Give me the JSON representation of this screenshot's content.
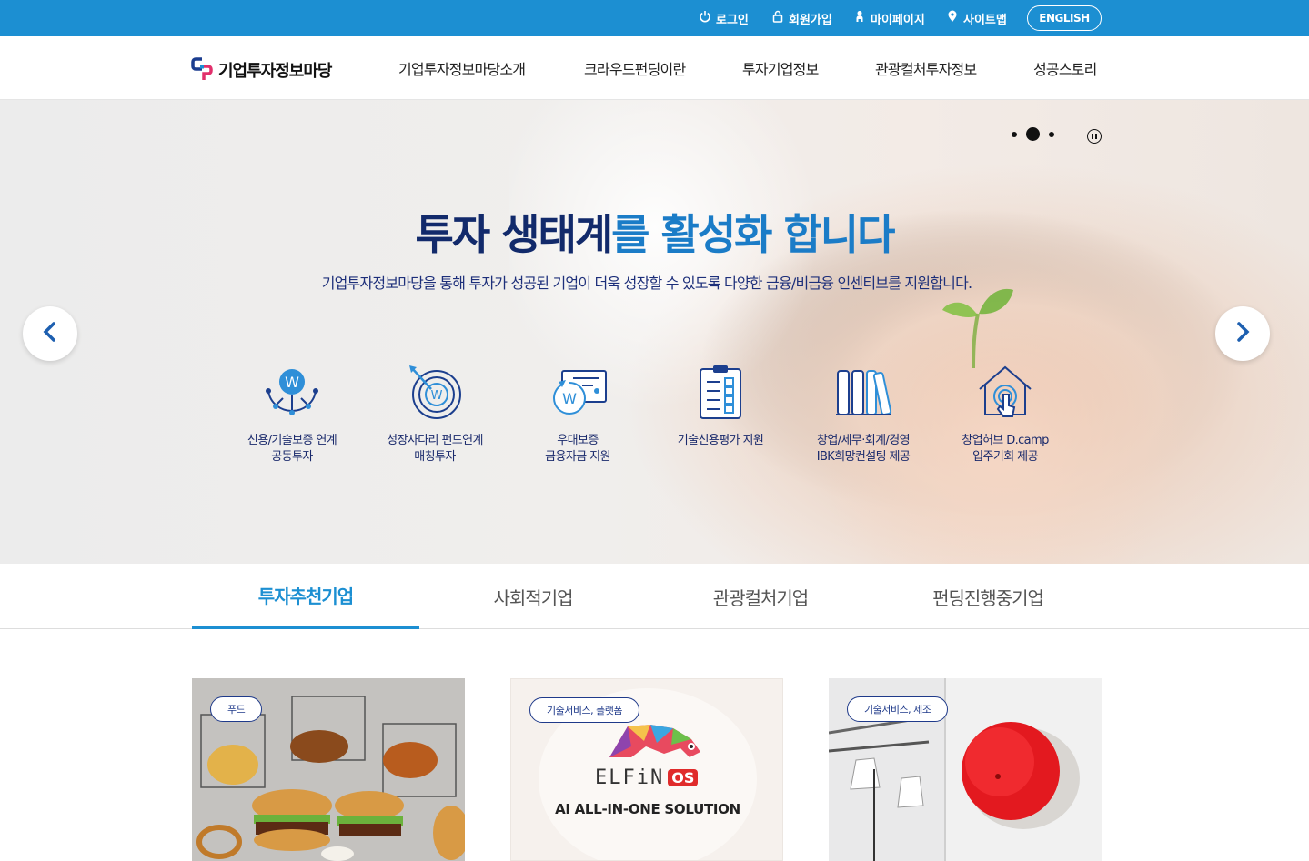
{
  "top_utility": {
    "login": "로그인",
    "signup": "회원가입",
    "mypage": "마이페이지",
    "sitemap": "사이트맵",
    "english": "ENGLISH"
  },
  "header": {
    "logo_text": "기업투자정보마당",
    "nav": [
      "기업투자정보마당소개",
      "크라우드펀딩이란",
      "투자기업정보",
      "관광컬처투자정보",
      "성공스토리"
    ]
  },
  "hero": {
    "title_part1": "투자 생태계",
    "title_part2": "를 활성화 합니다",
    "subtitle": "기업투자정보마당을 통해 투자가 성공된 기업이 더욱 성장할 수 있도록 다양한 금융/비금융 인센티브를 지원합니다.",
    "slide_count": 3,
    "active_slide": 2,
    "features": [
      {
        "icon": "network-w-icon",
        "label": "신용/기술보증 연계\n공동투자"
      },
      {
        "icon": "target-w-icon",
        "label": "성장사다리 펀드연계\n매칭투자"
      },
      {
        "icon": "card-w-icon",
        "label": "우대보증\n금융자금 지원"
      },
      {
        "icon": "checklist-icon",
        "label": "기술신용평가 지원"
      },
      {
        "icon": "books-icon",
        "label": "창업/세무·회계/경영\nIBK희망컨설팅 제공"
      },
      {
        "icon": "house-touch-icon",
        "label": "창업허브 D.camp\n입주기회 제공"
      }
    ]
  },
  "tabs": [
    {
      "label": "투자추천기업",
      "active": true
    },
    {
      "label": "사회적기업",
      "active": false
    },
    {
      "label": "관광컬처기업",
      "active": false
    },
    {
      "label": "펀딩진행중기업",
      "active": false
    }
  ],
  "cards": [
    {
      "category": "푸드"
    },
    {
      "category": "기술서비스, 플랫폼",
      "logo_text": "ELFiN",
      "logo_badge": "OS",
      "tagline": "AI ALL-IN-ONE SOLUTION"
    },
    {
      "category": "기술서비스, 제조"
    }
  ],
  "colors": {
    "topbar": "#1c8fd2",
    "accent": "#1c8fd2",
    "title_dark": "#122a6b",
    "title_blue": "#1b7cc7"
  }
}
